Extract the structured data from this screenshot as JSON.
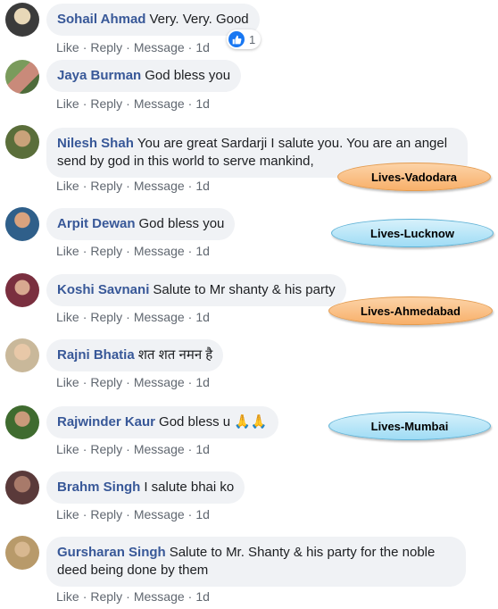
{
  "colors": {
    "author": "#385898",
    "bubble": "#f0f2f5",
    "meta": "#606770",
    "like": "#1877f2"
  },
  "comments": [
    {
      "author": "Sohail Ahmad",
      "text": "Very. Very. Good",
      "actions": {
        "like": "Like",
        "reply": "Reply",
        "message": "Message",
        "time": "1d"
      },
      "reactions": {
        "icon": "thumbs-up-icon",
        "count": "1"
      }
    },
    {
      "author": "Jaya Burman",
      "text": "God bless you",
      "actions": {
        "like": "Like",
        "reply": "Reply",
        "message": "Message",
        "time": "1d"
      }
    },
    {
      "author": "Nilesh Shah",
      "text": "You are great Sardarji I salute you. You are an angel send by god in this world to serve mankind,",
      "actions": {
        "like": "Like",
        "reply": "Reply",
        "message": "Message",
        "time": "1d"
      }
    },
    {
      "author": "Arpit Dewan",
      "text": "God bless you",
      "actions": {
        "like": "Like",
        "reply": "Reply",
        "message": "Message",
        "time": "1d"
      }
    },
    {
      "author": "Koshi Savnani",
      "text": "Salute to Mr shanty & his party",
      "actions": {
        "like": "Like",
        "reply": "Reply",
        "message": "Message",
        "time": "1d"
      }
    },
    {
      "author": "Rajni Bhatia",
      "text": "शत शत नमन है",
      "actions": {
        "like": "Like",
        "reply": "Reply",
        "message": "Message",
        "time": "1d"
      }
    },
    {
      "author": "Rajwinder Kaur",
      "text": "God bless u 🙏🙏",
      "actions": {
        "like": "Like",
        "reply": "Reply",
        "message": "Message",
        "time": "1d"
      }
    },
    {
      "author": "Brahm Singh",
      "text": "I salute bhai ko",
      "actions": {
        "like": "Like",
        "reply": "Reply",
        "message": "Message",
        "time": "1d"
      }
    },
    {
      "author": "Gursharan Singh",
      "text": "Salute to Mr. Shanty & his party for the noble deed being done by them",
      "actions": {
        "like": "Like",
        "reply": "Reply",
        "message": "Message",
        "time": "1d"
      }
    }
  ],
  "annotations": [
    {
      "label": "Lives-Vadodara",
      "style": "orange"
    },
    {
      "label": "Lives-Lucknow",
      "style": "blue"
    },
    {
      "label": "Lives-Ahmedabad",
      "style": "orange"
    },
    {
      "label": "Lives-Mumbai",
      "style": "blue"
    }
  ]
}
